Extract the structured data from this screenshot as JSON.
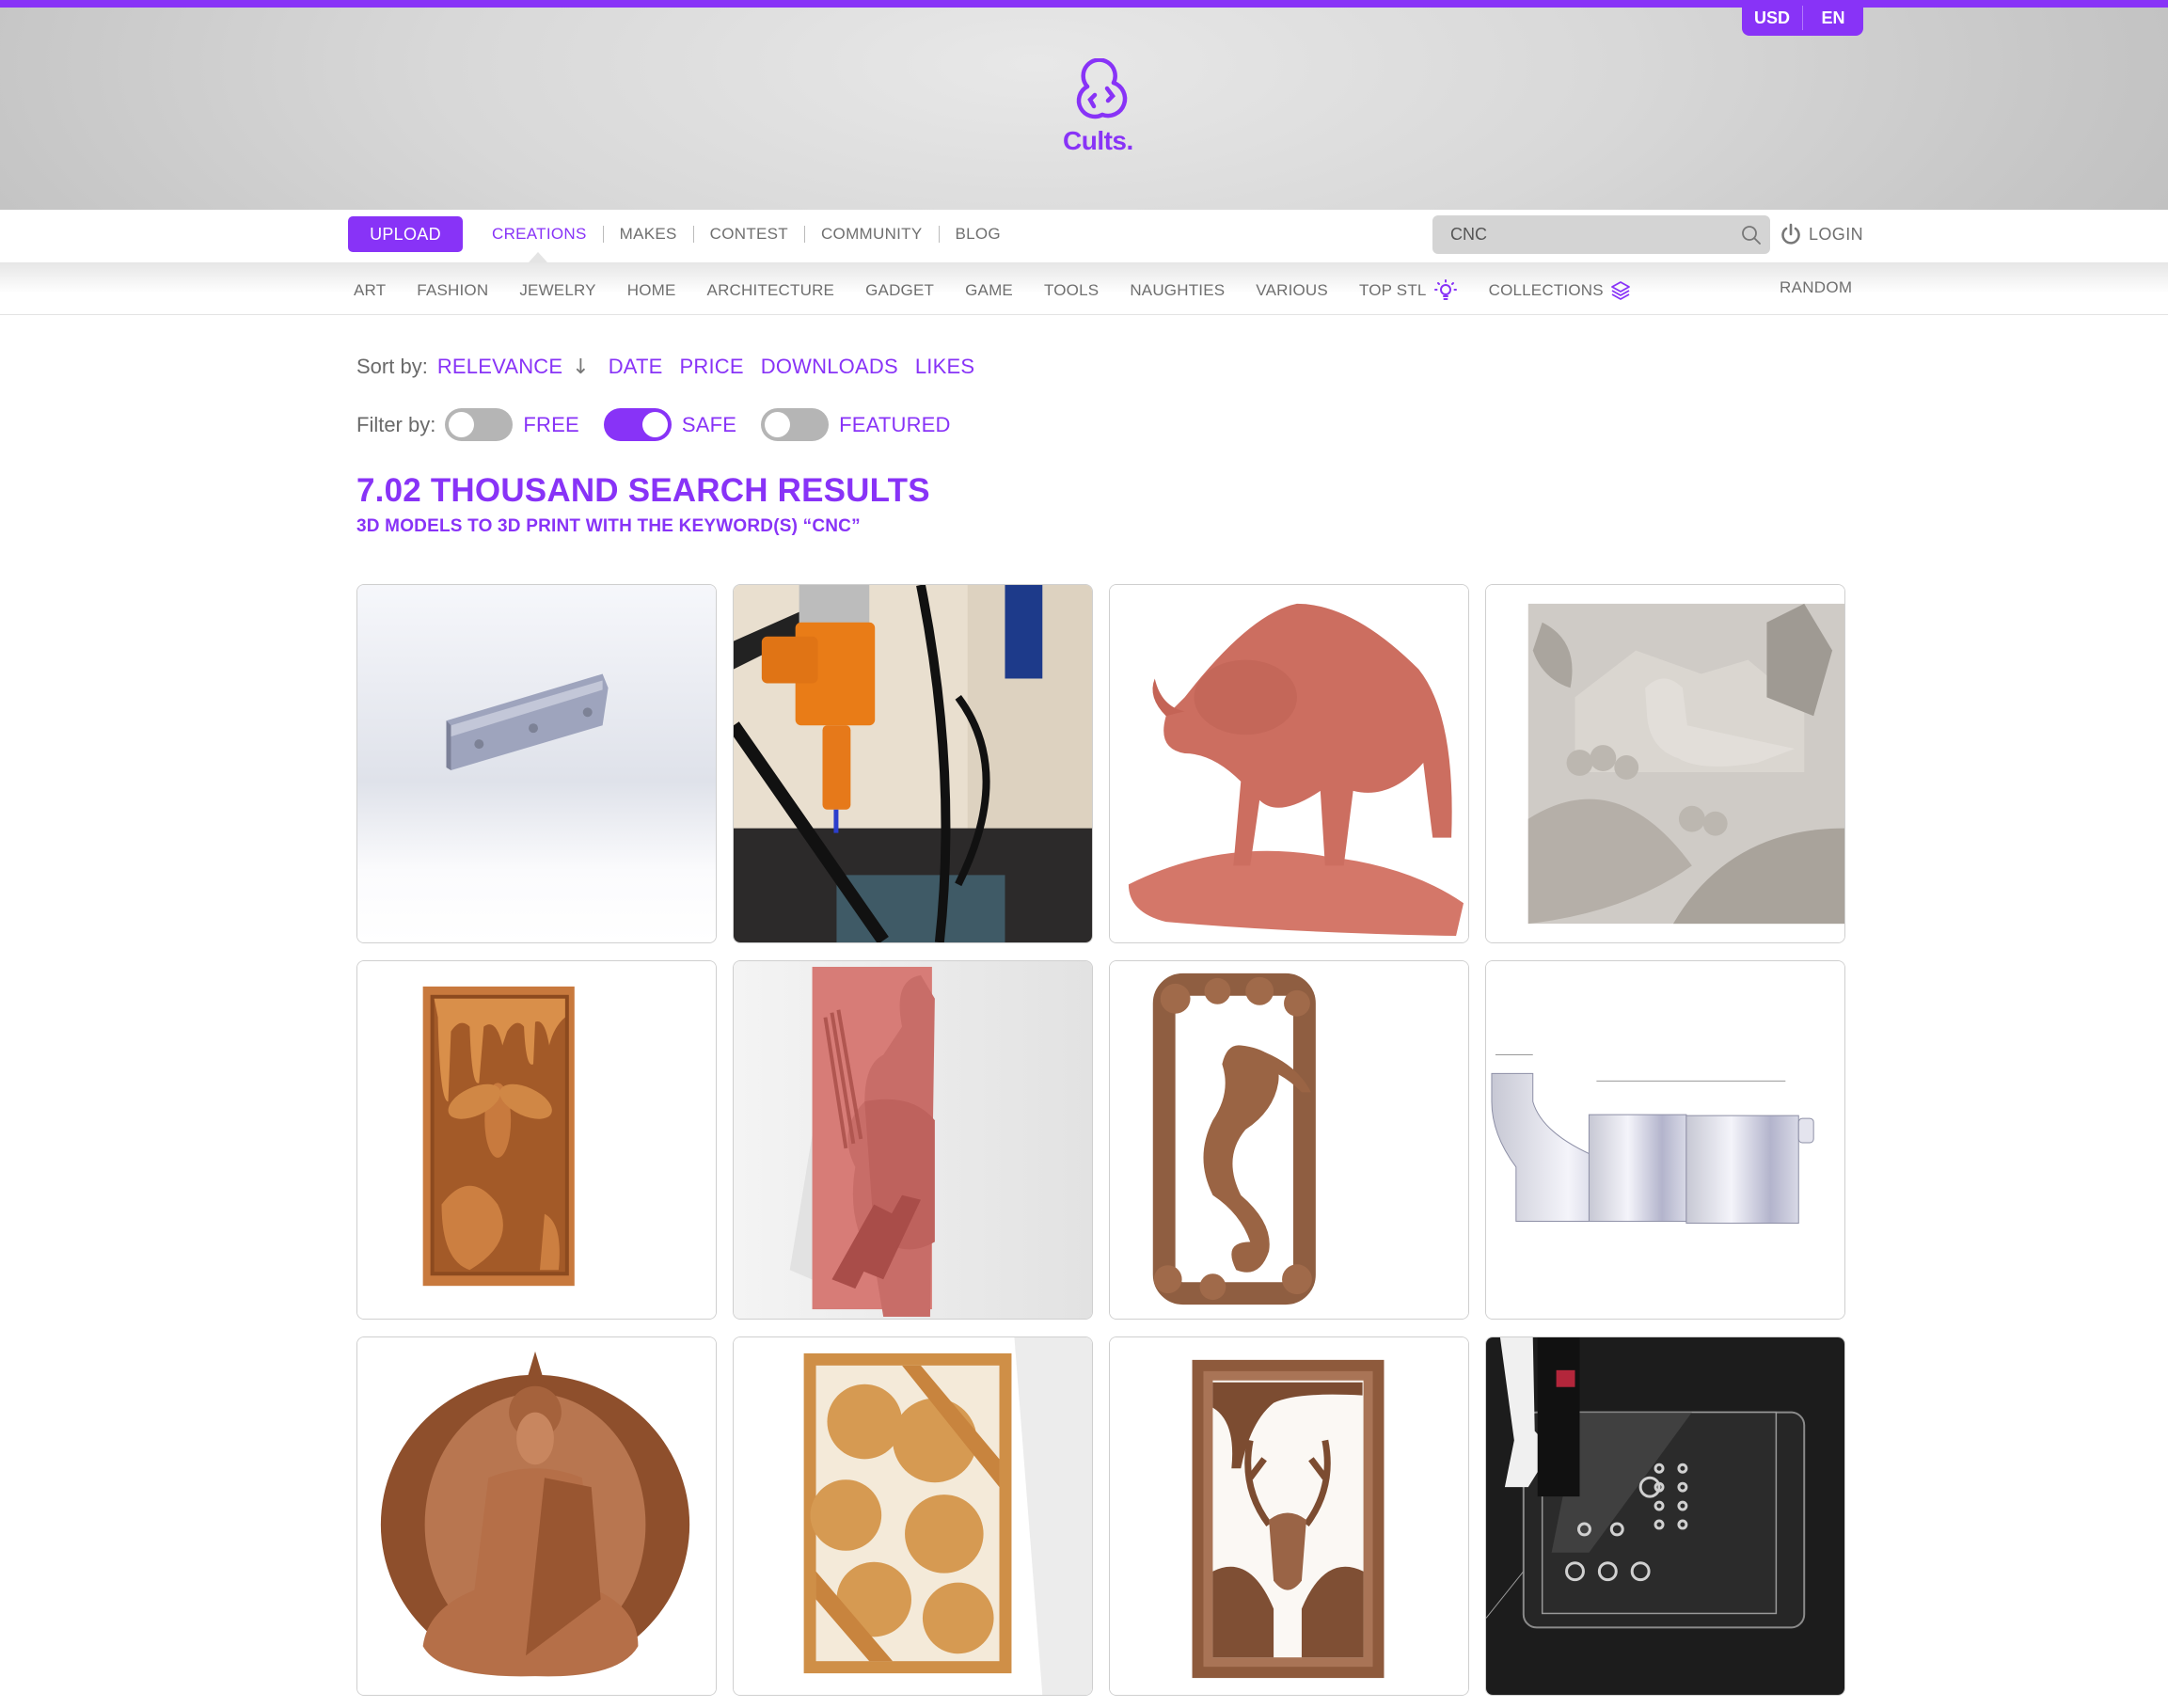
{
  "brand": {
    "name": "Cults.",
    "accent": "#8833f7",
    "currency": "USD",
    "language": "EN"
  },
  "mainnav": {
    "upload_label": "UPLOAD",
    "links": [
      {
        "label": "CREATIONS",
        "active": true
      },
      {
        "label": "MAKES",
        "active": false
      },
      {
        "label": "CONTEST",
        "active": false
      },
      {
        "label": "COMMUNITY",
        "active": false
      },
      {
        "label": "BLOG",
        "active": false
      }
    ],
    "search": {
      "value": "CNC",
      "icon": "search-icon"
    },
    "login_label": "LOGIN",
    "login_icon": "power-icon"
  },
  "categories": {
    "items": [
      {
        "label": "ART"
      },
      {
        "label": "FASHION"
      },
      {
        "label": "JEWELRY"
      },
      {
        "label": "HOME"
      },
      {
        "label": "ARCHITECTURE"
      },
      {
        "label": "GADGET"
      },
      {
        "label": "GAME"
      },
      {
        "label": "TOOLS"
      },
      {
        "label": "NAUGHTIES"
      },
      {
        "label": "VARIOUS"
      },
      {
        "label": "TOP STL",
        "icon": "lightbulb-icon"
      },
      {
        "label": "COLLECTIONS",
        "icon": "layers-icon"
      }
    ],
    "random_label": "RANDOM"
  },
  "sort": {
    "label": "Sort by:",
    "options": [
      "RELEVANCE",
      "DATE",
      "PRICE",
      "DOWNLOADS",
      "LIKES"
    ],
    "selected": "RELEVANCE",
    "direction_glyph": "↓"
  },
  "filter": {
    "label": "Filter by:",
    "toggles": [
      {
        "label": "FREE",
        "on": false
      },
      {
        "label": "SAFE",
        "on": true
      },
      {
        "label": "FEATURED",
        "on": false
      }
    ]
  },
  "results": {
    "title": "7.02 THOUSAND SEARCH RESULTS",
    "subtitle": "3D MODELS TO 3D PRINT WITH THE KEYWORD(S) “CNC”"
  },
  "grid": {
    "items": [
      {
        "subject": "gray aluminum rail bracket (CAD render)"
      },
      {
        "subject": "orange printed CNC spindle mount"
      },
      {
        "subject": "red clay bull sculpture"
      },
      {
        "subject": "white bird relief panel"
      },
      {
        "subject": "bee and honeycomb carved wood panel"
      },
      {
        "subject": "Wolverine X-MEN relief panel"
      },
      {
        "subject": "seahorse and seashell carved frame"
      },
      {
        "subject": "gray dust shoe adapter (CAD render)"
      },
      {
        "subject": "seated Buddha carved relief"
      },
      {
        "subject": "hibiscus flower carved panel"
      },
      {
        "subject": "deer head carved frame"
      },
      {
        "subject": "printed part on Ender 3 heated bed"
      }
    ]
  }
}
